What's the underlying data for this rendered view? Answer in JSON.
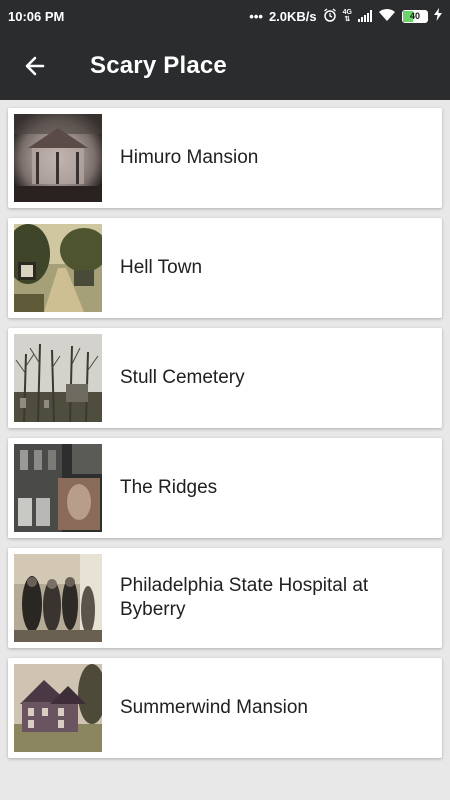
{
  "status": {
    "time": "10:06 PM",
    "speed": "2.0KB/s",
    "net": "4G",
    "battery": "40"
  },
  "app_bar": {
    "title": "Scary Place"
  },
  "items": [
    {
      "label": "Himuro Mansion"
    },
    {
      "label": "Hell Town"
    },
    {
      "label": "Stull Cemetery"
    },
    {
      "label": "The Ridges"
    },
    {
      "label": "Philadelphia State Hospital at Byberry"
    },
    {
      "label": "Summerwind Mansion"
    }
  ],
  "colors": {
    "app_bar": "#2b2c2e",
    "background": "#e8e8e8",
    "card": "#ffffff",
    "battery_fill": "#6ad36a"
  }
}
